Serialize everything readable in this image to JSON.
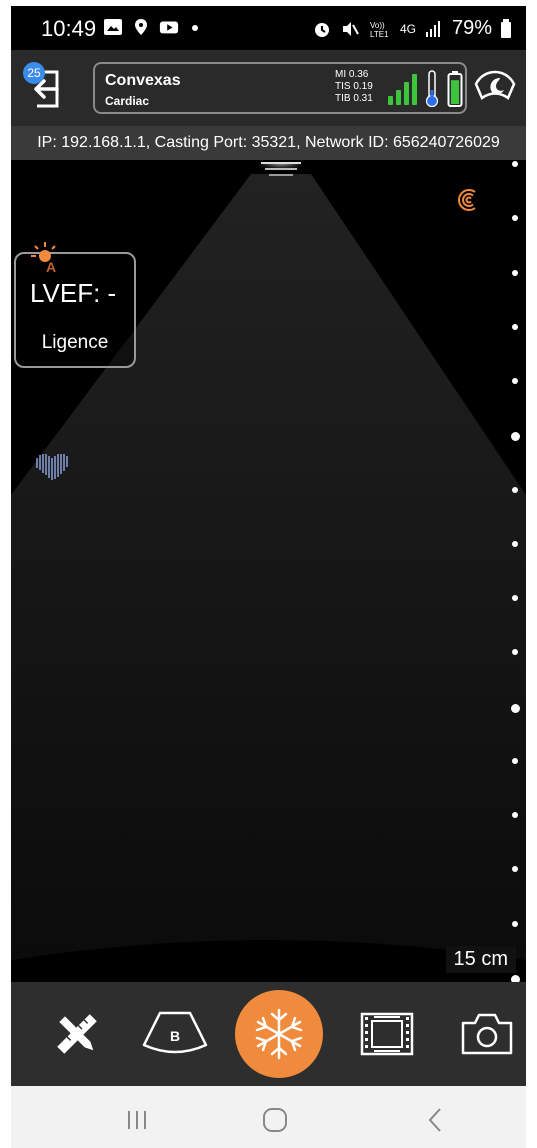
{
  "status_bar": {
    "time": "10:49",
    "battery_percent": "79%",
    "network": "4G",
    "icons": [
      "gallery-icon",
      "location-icon",
      "youtube-icon",
      "dot-icon",
      "alarm-icon",
      "mute-icon",
      "volte-icon",
      "signal-icon",
      "battery-icon"
    ]
  },
  "header": {
    "notification_count": "25",
    "probe_name": "Convexas",
    "preset": "Cardiac",
    "mi": "MI 0.36",
    "tis": "TIS 0.19",
    "tib": "TIB 0.31",
    "signal_level": 4,
    "battery_level": 0.85
  },
  "info_line": "IP: 192.168.1.1, Casting Port: 35321, Network ID: 656240726029",
  "overlay": {
    "lvef_label": "LVEF: -",
    "user": "Ligence",
    "depth": "15 cm"
  },
  "depth_scale": {
    "major_indices": [
      5,
      10,
      15
    ],
    "count": 16
  },
  "toolbar": {
    "items": [
      "measure-tools",
      "b-mode",
      "freeze",
      "cine",
      "capture"
    ],
    "mode_label": "B"
  },
  "colors": {
    "accent_orange": "#f08a3c",
    "header_bg": "#2a2a2a",
    "signal_green": "#3ec53e",
    "thermo_blue": "#2d6ee8",
    "badge_blue": "#3b8beb"
  }
}
